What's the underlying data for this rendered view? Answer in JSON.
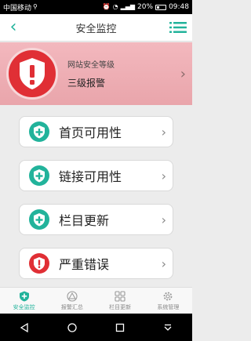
{
  "status_bar": {
    "carrier": "中国移动",
    "battery": "20%",
    "time": "09:48"
  },
  "header": {
    "title": "安全监控"
  },
  "banner": {
    "subtitle": "网站安全等级",
    "level": "三级报警"
  },
  "list": [
    {
      "label": "首页可用性",
      "icon": "shield-plus-icon",
      "color": "#22b39b"
    },
    {
      "label": "链接可用性",
      "icon": "shield-plus-icon",
      "color": "#22b39b"
    },
    {
      "label": "栏目更新",
      "icon": "shield-plus-icon",
      "color": "#22b39b"
    },
    {
      "label": "严重错误",
      "icon": "shield-exclamation-icon",
      "color": "#e02f35"
    }
  ],
  "tabs": [
    {
      "label": "安全监控",
      "icon": "shield-plus-icon",
      "active": true
    },
    {
      "label": "报警汇总",
      "icon": "alert-summary-icon",
      "active": false
    },
    {
      "label": "栏目更新",
      "icon": "grid-icon",
      "active": false
    },
    {
      "label": "系统管理",
      "icon": "settings-icon",
      "active": false
    }
  ],
  "colors": {
    "accent": "#22b39b",
    "alert": "#e02f35"
  }
}
